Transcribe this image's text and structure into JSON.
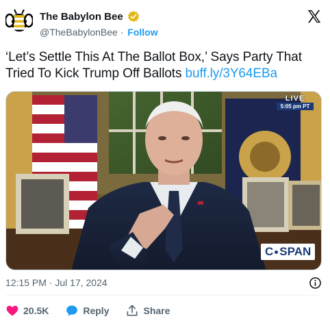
{
  "author": {
    "name": "The Babylon Bee",
    "handle": "@TheBabylonBee",
    "separator": "·",
    "follow_label": "Follow"
  },
  "tweet": {
    "text": "‘Let’s Settle This At The Ballot Box,’ Says Party That Tried To Kick Trump Off Ballots ",
    "link": "buff.ly/3Y64EBa"
  },
  "media": {
    "live_label": "LIVE",
    "live_time": "5:05 pm PT",
    "network_logo": "C-SPAN",
    "network_logo_prefix": "C",
    "network_logo_suffix": "SPAN"
  },
  "timestamp": "12:15 PM · Jul 17, 2024",
  "actions": {
    "like_count": "20.5K",
    "reply_label": "Reply",
    "share_label": "Share"
  },
  "colors": {
    "accent": "#1d9bf0",
    "like": "#f91880",
    "verified": "#e2b719",
    "text_secondary": "#536471"
  },
  "icons": {
    "avatar": "bee-logo-icon",
    "verified": "verified-badge-icon",
    "platform": "x-logo-icon",
    "info": "info-icon",
    "like": "heart-icon",
    "reply": "reply-bubble-icon",
    "share": "share-icon"
  }
}
